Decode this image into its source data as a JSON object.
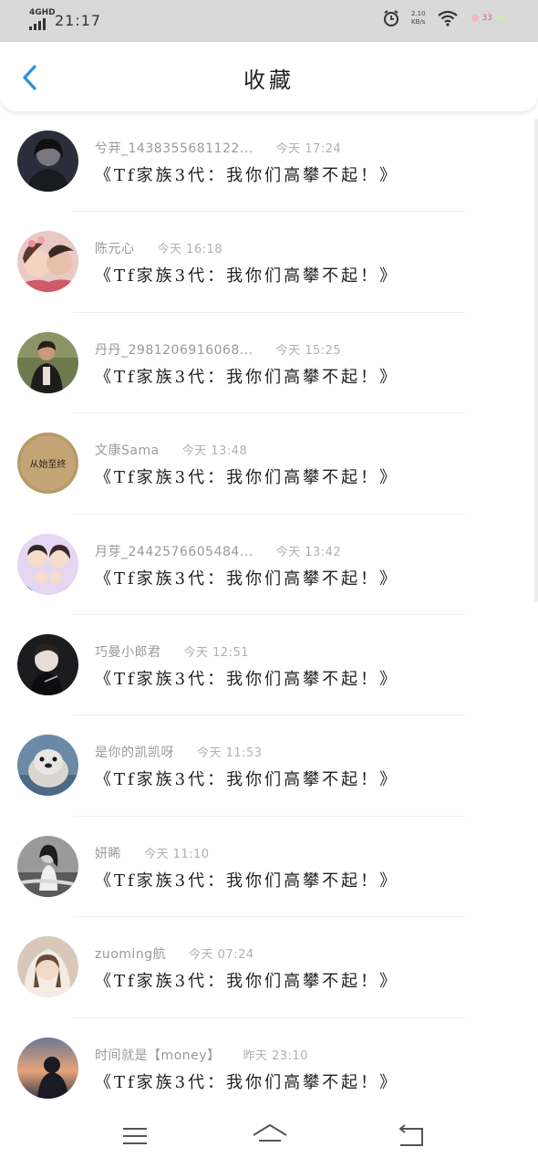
{
  "status_bar": {
    "network": "4GHD",
    "time": "21:17",
    "speed_value": "2.10",
    "speed_unit": "KB/s",
    "battery": "33",
    "icons": [
      "signal-icon",
      "alarm-icon",
      "wifi-icon",
      "battery-icon"
    ]
  },
  "header": {
    "title": "收藏",
    "back_icon": "chevron-left-icon",
    "accent_color": "#2a8fe0"
  },
  "items": [
    {
      "name": "兮荓_1438355681122...",
      "time": "今天 17:24",
      "message": "《Tf家族3代：我你们高攀不起！》",
      "avatar": "dark-hair-portrait"
    },
    {
      "name": "陈元心",
      "time": "今天 16:18",
      "message": "《Tf家族3代：我你们高攀不起！》",
      "avatar": "two-girls-selfie"
    },
    {
      "name": "丹丹_2981206916068...",
      "time": "今天 15:25",
      "message": "《Tf家族3代：我你们高攀不起！》",
      "avatar": "woman-outdoors"
    },
    {
      "name": "文康Sama",
      "time": "今天 13:48",
      "message": "《Tf家族3代：我你们高攀不起！》",
      "avatar": "text-badge",
      "avatar_text": "从始至终"
    },
    {
      "name": "月芽_2442576605484...",
      "time": "今天 13:42",
      "message": "《Tf家族3代：我你们高攀不起！》",
      "avatar": "cartoon-family"
    },
    {
      "name": "巧曼小郎君",
      "time": "今天 12:51",
      "message": "《Tf家族3代：我你们高攀不起！》",
      "avatar": "young-man-dark"
    },
    {
      "name": "是你的凯凯呀",
      "time": "今天 11:53",
      "message": "《Tf家族3代：我你们高攀不起！》",
      "avatar": "seal-photo"
    },
    {
      "name": "妍睎",
      "time": "今天 11:10",
      "message": "《Tf家族3代：我你们高攀不起！》",
      "avatar": "girl-bw-photo"
    },
    {
      "name": "zuoming航",
      "time": "今天 07:24",
      "message": "《Tf家族3代：我你们高攀不起！》",
      "avatar": "girl-hood-photo"
    },
    {
      "name": "时间就是【money】",
      "time": "昨天 23:10",
      "message": "《Tf家族3代：我你们高攀不起！》",
      "avatar": "sunset-silhouette"
    }
  ],
  "nav_bar": {
    "buttons": [
      "menu-icon",
      "home-icon",
      "back-arrow-icon"
    ]
  }
}
